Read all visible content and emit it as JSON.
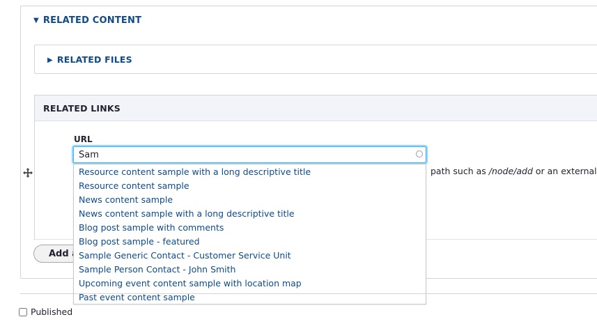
{
  "related_content": {
    "title": "RELATED CONTENT",
    "related_files_title": "RELATED FILES",
    "related_links_title": "RELATED LINKS"
  },
  "url_field": {
    "label": "URL",
    "value": "Sam",
    "help_prefix": "path such as ",
    "help_example": "/node/add",
    "help_suffix": " or an external U"
  },
  "autocomplete": {
    "items": [
      "Resource content sample with a long descriptive title",
      "Resource content sample",
      "News content sample",
      "News content sample with a long descriptive title",
      "Blog post sample with comments",
      "Blog post sample - featured",
      "Sample Generic Contact - Customer Service Unit",
      "Sample Person Contact - John Smith",
      "Upcoming event content sample with location map",
      "Past event content sample"
    ]
  },
  "add_button_label": "Add a",
  "published_label": "Published",
  "icons": {
    "expanded": "triangle-down-icon",
    "collapsed": "triangle-right-icon",
    "drag": "move-arrows-icon",
    "loading": "throbber-icon"
  }
}
